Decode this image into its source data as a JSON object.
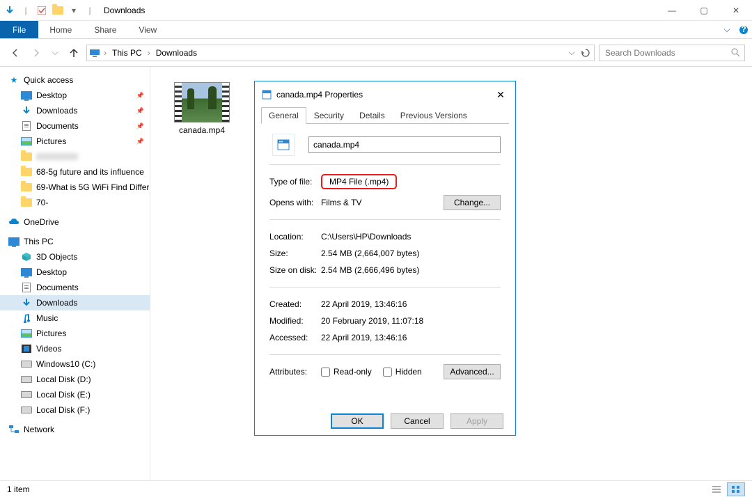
{
  "window": {
    "title": "Downloads",
    "min": "—",
    "max": "▢",
    "close": "✕",
    "chev": "⌵",
    "help": "❔"
  },
  "ribbon": {
    "file": "File",
    "tabs": [
      "Home",
      "Share",
      "View"
    ]
  },
  "address": {
    "crumbs": [
      "This PC",
      "Downloads"
    ],
    "searchPlaceholder": "Search Downloads"
  },
  "nav": {
    "quickAccess": "Quick access",
    "qaItems": [
      {
        "label": "Desktop",
        "icon": "monitor",
        "pin": true
      },
      {
        "label": "Downloads",
        "icon": "down",
        "pin": true
      },
      {
        "label": "Documents",
        "icon": "doc",
        "pin": true
      },
      {
        "label": "Pictures",
        "icon": "pic",
        "pin": true
      },
      {
        "label": "",
        "icon": "folder",
        "pin": false,
        "blur": true
      },
      {
        "label": "68-5g future and its influence",
        "icon": "folder",
        "pin": false
      },
      {
        "label": "69-What is 5G WiFi Find Differ",
        "icon": "folder",
        "pin": false
      },
      {
        "label": "70-",
        "icon": "folder",
        "pin": false
      }
    ],
    "oneDrive": "OneDrive",
    "thisPC": "This PC",
    "pcItems": [
      {
        "label": "3D Objects",
        "icon": "cube"
      },
      {
        "label": "Desktop",
        "icon": "monitor"
      },
      {
        "label": "Documents",
        "icon": "doc"
      },
      {
        "label": "Downloads",
        "icon": "down",
        "sel": true
      },
      {
        "label": "Music",
        "icon": "music"
      },
      {
        "label": "Pictures",
        "icon": "pic"
      },
      {
        "label": "Videos",
        "icon": "video"
      },
      {
        "label": "Windows10 (C:)",
        "icon": "drive"
      },
      {
        "label": "Local Disk (D:)",
        "icon": "drive"
      },
      {
        "label": "Local Disk (E:)",
        "icon": "drive"
      },
      {
        "label": "Local Disk (F:)",
        "icon": "drive"
      }
    ],
    "network": "Network"
  },
  "content": {
    "fileName": "canada.mp4"
  },
  "status": {
    "text": "1 item"
  },
  "props": {
    "title": "canada.mp4 Properties",
    "tabs": [
      "General",
      "Security",
      "Details",
      "Previous Versions"
    ],
    "filename": "canada.mp4",
    "labels": {
      "typeOfFile": "Type of file:",
      "opensWith": "Opens with:",
      "location": "Location:",
      "size": "Size:",
      "sizeOnDisk": "Size on disk:",
      "created": "Created:",
      "modified": "Modified:",
      "accessed": "Accessed:",
      "attributes": "Attributes:",
      "readOnly": "Read-only",
      "hidden": "Hidden"
    },
    "typeOfFile": "MP4 File (.mp4)",
    "opensWith": "Films & TV",
    "change": "Change...",
    "location": "C:\\Users\\HP\\Downloads",
    "size": "2.54 MB (2,664,007 bytes)",
    "sizeOnDisk": "2.54 MB (2,666,496 bytes)",
    "created": "22 April 2019, 13:46:16",
    "modified": "20 February 2019, 11:07:18",
    "accessed": "22 April 2019, 13:46:16",
    "advanced": "Advanced...",
    "ok": "OK",
    "cancel": "Cancel",
    "apply": "Apply"
  }
}
